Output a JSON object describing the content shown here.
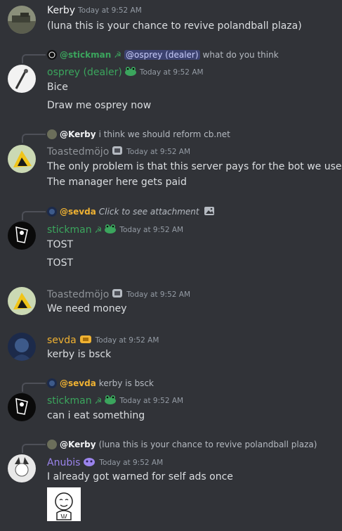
{
  "colors": {
    "background": "#313338",
    "text": "#dbdee1",
    "muted": "#949ba4",
    "osprey": "#3ba55d",
    "stickman": "#3ba55d",
    "toast": "#8e9297",
    "sevda": "#f0b232",
    "anubis": "#9b84ec",
    "kerby": "#f2f3f5"
  },
  "messages": [
    {
      "author": "Kerby",
      "timestamp": "Today at 9:52 AM",
      "lines": [
        "(luna this is your chance to revive polandball plaza)"
      ]
    },
    {
      "reply": {
        "author": "@stickman",
        "mention": "@osprey (dealer)",
        "text": "what do you think"
      },
      "author": "osprey (dealer)",
      "timestamp": "Today at 9:52 AM",
      "lines": [
        "Bice",
        "Draw me osprey now"
      ]
    },
    {
      "reply": {
        "author": "@Kerby",
        "text": "i think we should reform cb.net"
      },
      "author": "Toastedmöjo",
      "timestamp": "Today at 9:52 AM",
      "lines": [
        "The only problem is that this server pays for the bot we use",
        "The manager here gets paid"
      ]
    },
    {
      "reply": {
        "author": "@sevda",
        "text": "Click to see attachment"
      },
      "author": "stickman",
      "timestamp": "Today at 9:52 AM",
      "lines": [
        "TOST",
        "TOST"
      ]
    },
    {
      "author": "Toastedmöjo",
      "timestamp": "Today at 9:52 AM",
      "lines": [
        "We need money"
      ]
    },
    {
      "author": "sevda",
      "timestamp": "Today at 9:52 AM",
      "lines": [
        "kerby is bsck"
      ]
    },
    {
      "reply": {
        "author": "@sevda",
        "text": "kerby is bsck"
      },
      "author": "stickman",
      "timestamp": "Today at 9:52 AM",
      "lines": [
        "can i eat something"
      ]
    },
    {
      "reply": {
        "author": "@Kerby",
        "text": "(luna this is your chance to revive polandball plaza)"
      },
      "author": "Anubis",
      "timestamp": "Today at 9:52 AM",
      "lines": [
        "I already got warned for self ads once"
      ]
    }
  ]
}
